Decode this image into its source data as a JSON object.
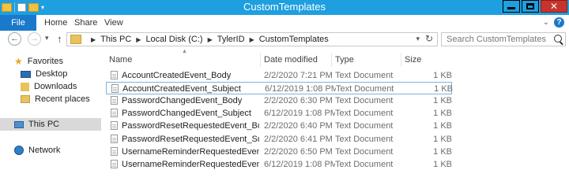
{
  "window": {
    "title": "CustomTemplates"
  },
  "ribbon": {
    "file": "File",
    "home": "Home",
    "share": "Share",
    "view": "View",
    "help": "?"
  },
  "address": {
    "crumbs": [
      "This PC",
      "Local Disk (C:)",
      "TylerID",
      "CustomTemplates"
    ],
    "search_placeholder": "Search CustomTemplates"
  },
  "sidebar": {
    "favorites": "Favorites",
    "desktop": "Desktop",
    "downloads": "Downloads",
    "recent": "Recent places",
    "thispc": "This PC",
    "network": "Network"
  },
  "columns": {
    "name": "Name",
    "date": "Date modified",
    "type": "Type",
    "size": "Size"
  },
  "files": [
    {
      "name": "AccountCreatedEvent_Body",
      "date": "2/2/2020 7:21 PM",
      "type": "Text Document",
      "size": "1 KB"
    },
    {
      "name": "AccountCreatedEvent_Subject",
      "date": "6/12/2019 1:08 PM",
      "type": "Text Document",
      "size": "1 KB"
    },
    {
      "name": "PasswordChangedEvent_Body",
      "date": "2/2/2020 6:30 PM",
      "type": "Text Document",
      "size": "1 KB"
    },
    {
      "name": "PasswordChangedEvent_Subject",
      "date": "6/12/2019 1:08 PM",
      "type": "Text Document",
      "size": "1 KB"
    },
    {
      "name": "PasswordResetRequestedEvent_Body",
      "date": "2/2/2020 6:40 PM",
      "type": "Text Document",
      "size": "1 KB"
    },
    {
      "name": "PasswordResetRequestedEvent_Subject",
      "date": "2/2/2020 6:41 PM",
      "type": "Text Document",
      "size": "1 KB"
    },
    {
      "name": "UsernameReminderRequestedEvent_Body",
      "date": "2/2/2020 6:50 PM",
      "type": "Text Document",
      "size": "1 KB"
    },
    {
      "name": "UsernameReminderRequestedEvent_Subj...",
      "date": "6/12/2019 1:08 PM",
      "type": "Text Document",
      "size": "1 KB"
    }
  ]
}
